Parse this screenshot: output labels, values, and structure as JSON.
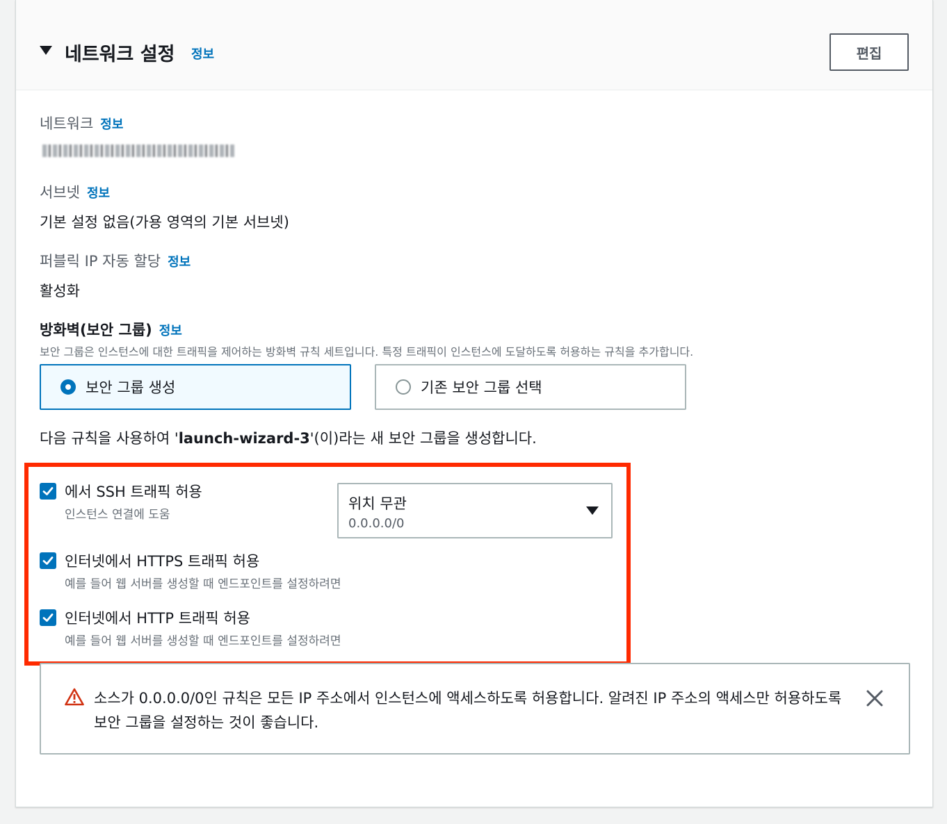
{
  "header": {
    "title": "네트워크 설정",
    "info": "정보",
    "edit_label": "편집"
  },
  "network": {
    "label": "네트워크",
    "info": "정보",
    "value_redacted": true
  },
  "subnet": {
    "label": "서브넷",
    "info": "정보",
    "value": "기본 설정 없음(가용 영역의 기본 서브넷)"
  },
  "public_ip": {
    "label": "퍼블릭 IP 자동 할당",
    "info": "정보",
    "value": "활성화"
  },
  "firewall": {
    "title": "방화벽(보안 그룹)",
    "info": "정보",
    "description": "보안 그룹은 인스턴스에 대한 트래픽을 제어하는 방화벽 규칙 세트입니다. 특정 트래픽이 인스턴스에 도달하도록 허용하는 규칙을 추가합니다.",
    "options": [
      {
        "label": "보안 그룹 생성",
        "selected": true
      },
      {
        "label": "기존 보안 그룹 선택",
        "selected": false
      }
    ],
    "rule_prefix": "다음 규칙을 사용하여 '",
    "rule_name": "launch-wizard-3",
    "rule_suffix": "'(이)라는 새 보안 그룹을 생성합니다."
  },
  "rules": [
    {
      "label": "에서 SSH 트래픽 허용",
      "description": "인스턴스 연결에 도움",
      "checked": true
    },
    {
      "label": "인터넷에서 HTTPS 트래픽 허용",
      "description": "예를 들어 웹 서버를 생성할 때 엔드포인트를 설정하려면",
      "checked": true
    },
    {
      "label": "인터넷에서 HTTP 트래픽 허용",
      "description": "예를 들어 웹 서버를 생성할 때 엔드포인트를 설정하려면",
      "checked": true
    }
  ],
  "ssh_source": {
    "selected": "위치 무관",
    "cidr": "0.0.0.0/0"
  },
  "alert": {
    "text": "소스가 0.0.0.0/0인 규칙은 모든 IP 주소에서 인스턴스에 액세스하도록 허용합니다. 알려진 IP 주소의 액세스만 허용하도록 보안 그룹을 설정하는 것이 좋습니다."
  },
  "colors": {
    "accent": "#0073bb",
    "highlight": "#ff2a00",
    "warning": "#d13212"
  }
}
